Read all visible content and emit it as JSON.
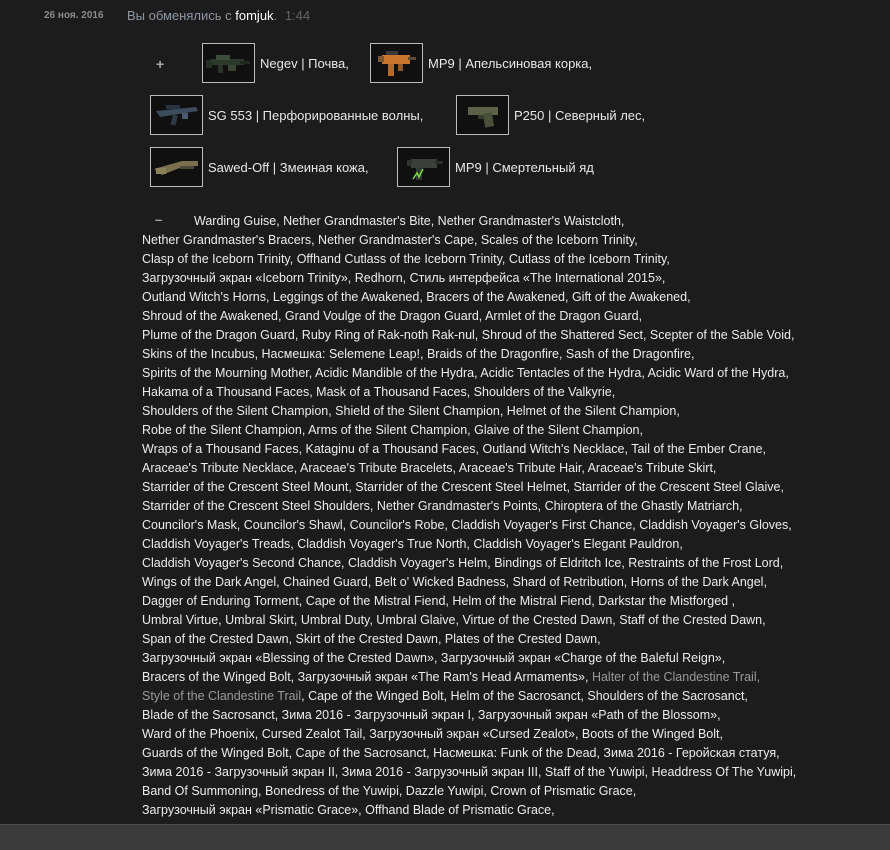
{
  "history": {
    "date": "26 ноя. 2016",
    "summary_prefix": "Вы обменялись с",
    "user": "fomjuk",
    "summary_suffix": ".",
    "time": "1:44"
  },
  "received": {
    "sign": "+",
    "items": [
      {
        "label": "Negev | Почва,",
        "icon": "negev-icon",
        "color": "#2c3a2c"
      },
      {
        "label": "MP9 | Апельсиновая корка,",
        "icon": "mp9-orange-icon",
        "color": "#c8762e"
      },
      {
        "label": "SG 553 | Перфорированные волны,",
        "icon": "sg553-icon",
        "color": "#3d4b5e"
      },
      {
        "label": "P250 | Северный лес,",
        "icon": "p250-icon",
        "color": "#5b6247"
      },
      {
        "label": "Sawed-Off | Змеиная кожа,",
        "icon": "sawedoff-icon",
        "color": "#7a7050"
      },
      {
        "label": "MP9 | Смертельный яд",
        "icon": "mp9-poison-icon",
        "color": "#3b3f3a"
      }
    ]
  },
  "given": {
    "sign": "–",
    "lines": [
      "Warding Guise, Nether Grandmaster's Bite, Nether Grandmaster's Waistcloth,",
      "Nether Grandmaster's Bracers, Nether Grandmaster's Cape, Scales of the Iceborn Trinity,",
      "Clasp of the Iceborn Trinity, Offhand Cutlass of the Iceborn Trinity, Cutlass of the Iceborn Trinity,",
      "Загрузочный экран «Iceborn Trinity», Redhorn, Стиль интерфейса «The International 2015»,",
      "Outland Witch's Horns, Leggings of the Awakened, Bracers of the Awakened, Gift of the Awakened,",
      "Shroud of the Awakened, Grand Voulge of the Dragon Guard, Armlet of the Dragon Guard,",
      "Plume of the Dragon Guard, Ruby Ring of Rak-noth Rak-nul, Shroud of the Shattered Sect, Scepter of the Sable Void,",
      "Skins of the Incubus, Насмешка: Selemene Leap!, Braids of the Dragonfire, Sash of the Dragonfire,",
      "Spirits of the Mourning Mother, Acidic Mandible of the Hydra, Acidic Tentacles of the Hydra, Acidic Ward of the Hydra,",
      "Hakama of a Thousand Faces, Mask of a Thousand Faces, Shoulders of the Valkyrie,",
      "Shoulders of the Silent Champion, Shield of the Silent Champion, Helmet of the Silent Champion,",
      "Robe of the Silent Champion, Arms of the Silent Champion, Glaive of the Silent Champion,",
      "Wraps of a Thousand Faces, Kataginu of a Thousand Faces, Outland Witch's Necklace, Tail of the Ember Crane,",
      "Araceae's Tribute Necklace, Araceae's Tribute Bracelets, Araceae's Tribute Hair, Araceae's Tribute Skirt,",
      "Starrider of the Crescent Steel Mount, Starrider of the Crescent Steel Helmet, Starrider of the Crescent Steel Glaive,",
      "Starrider of the Crescent Steel Shoulders, Nether Grandmaster's Points, Chiroptera of the Ghastly Matriarch,",
      "Councilor's Mask, Councilor's Shawl, Councilor's Robe, Claddish Voyager's First Chance, Claddish Voyager's Gloves,",
      "Claddish Voyager's Treads, Claddish Voyager's True North, Claddish Voyager's Elegant Pauldron,",
      "Claddish Voyager's Second Chance, Claddish Voyager's Helm, Bindings of Eldritch Ice, Restraints of the Frost Lord,",
      "Wings of the Dark Angel, Chained Guard, Belt o' Wicked Badness, Shard of Retribution, Horns of the Dark Angel,",
      "Dagger of Enduring Torment, Cape of the Mistral Fiend, Helm of the Mistral Fiend, Darkstar the Mistforged ,",
      "Umbral Virtue, Umbral Skirt, Umbral Duty, Umbral Glaive, Virtue of the Crested Dawn, Staff of the Crested Dawn,",
      "Span of the Crested Dawn, Skirt of the Crested Dawn, Plates of the Crested Dawn,",
      "Загрузочный экран «Blessing of the Crested Dawn», Загрузочный экран «Charge of the Baleful Reign»,"
    ],
    "line_25_a": "Bracers of the Winged Bolt, Загрузочный экран «The Ram's Head Armaments», ",
    "line_25_b": "Halter of the Clandestine Trail,",
    "line_26_a": "Style of the Clandestine Trail",
    "line_26_b": ", Cape of the Winged Bolt, Helm of the Sacrosanct, Shoulders of the Sacrosanct,",
    "lines_tail": [
      "Blade of the Sacrosanct, Зима 2016 - Загрузочный экран I, Загрузочный экран «Path of the Blossom»,",
      "Ward of the Phoenix, Cursed Zealot Tail, Загрузочный экран «Cursed Zealot», Boots of the Winged Bolt,",
      "Guards of the Winged Bolt, Cape of the Sacrosanct, Насмешка: Funk of the Dead, Зима 2016 - Геройская статуя,",
      "Зима 2016 - Загрузочный экран II, Зима 2016 - Загрузочный экран III, Staff of the Yuwipi, Headdress Of The Yuwipi,",
      "Band Of Summoning, Bonedress of the Yuwipi, Dazzle Yuwipi, Crown of Prismatic Grace,",
      "Загрузочный экран «Prismatic Grace», Offhand Blade of Prismatic Grace,"
    ]
  }
}
